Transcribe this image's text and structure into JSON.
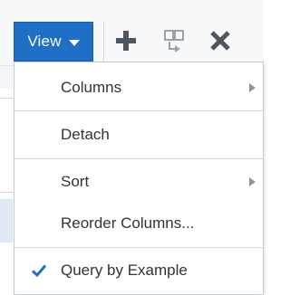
{
  "toolbar": {
    "view_label": "View",
    "icons": {
      "dropdown": "caret-down-icon",
      "add": "plus-icon",
      "detach": "detach-icon",
      "remove": "close-x-icon"
    }
  },
  "menu": {
    "items": [
      {
        "label": "Columns",
        "has_submenu": true
      },
      {
        "label": "Detach",
        "has_submenu": false
      },
      {
        "label": "Sort",
        "has_submenu": true
      },
      {
        "label": "Reorder Columns...",
        "has_submenu": false
      },
      {
        "label": "Query by Example",
        "checked": true
      }
    ]
  },
  "colors": {
    "accent": "#1f6fc6",
    "icon": "#4d5660",
    "text": "#333333",
    "check": "#1f6fc6"
  }
}
